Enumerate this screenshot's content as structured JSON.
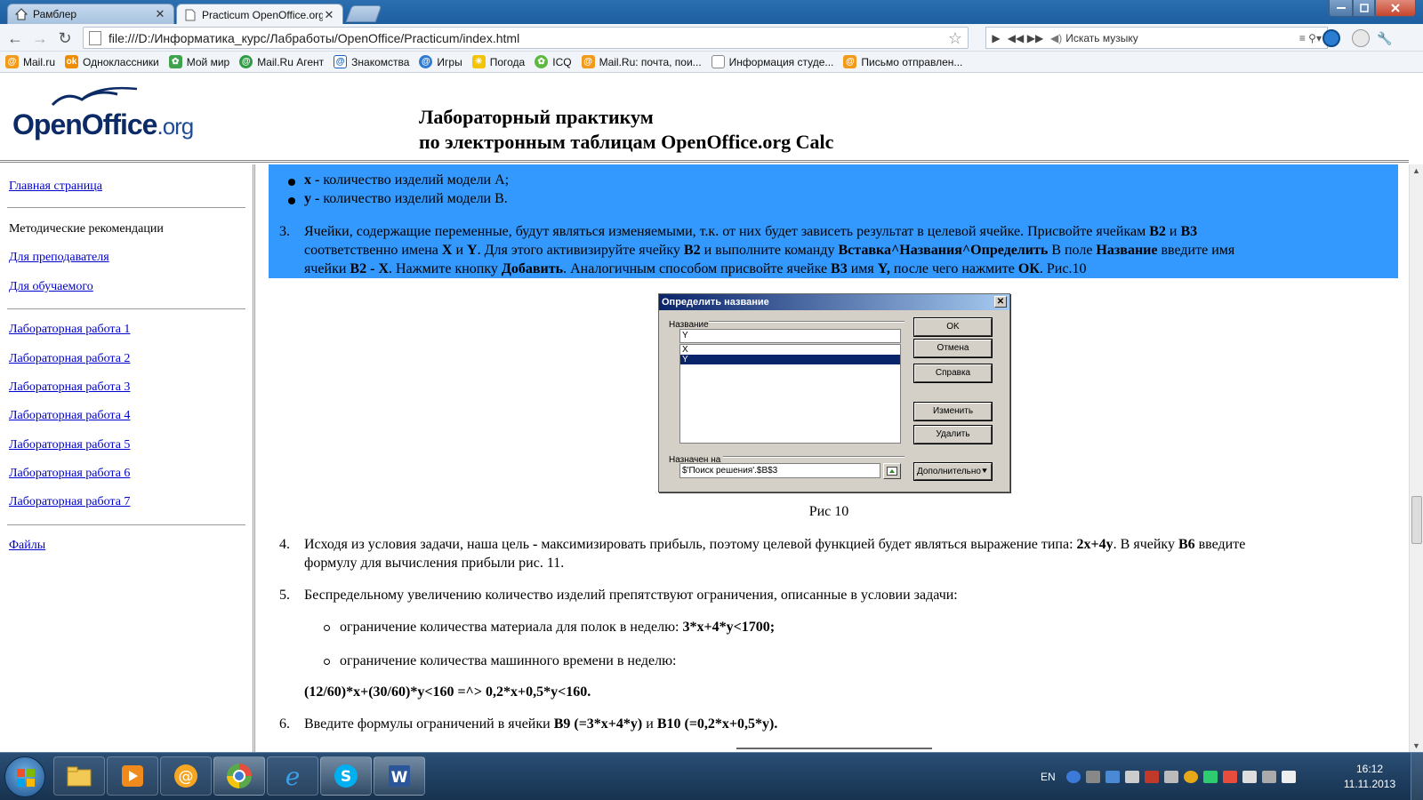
{
  "browser": {
    "tabs": [
      {
        "label": "Рамблер",
        "icon": "home-icon"
      },
      {
        "label": "Practicum OpenOffice.org",
        "icon": "page-icon"
      }
    ],
    "address": "file:///D:/Информатика_курс/Лабработы/OpenOffice/Practicum/index.html",
    "music_search_placeholder": "Искать музыку",
    "bookmarks": [
      {
        "label": "Mail.ru",
        "icon": "mailru-icon"
      },
      {
        "label": "Одноклассники",
        "icon": "odnoklassniki-icon"
      },
      {
        "label": "Мой мир",
        "icon": "my-world-icon"
      },
      {
        "label": "Mail.Ru Агент",
        "icon": "agent-icon"
      },
      {
        "label": "Знакомства",
        "icon": "dating-icon"
      },
      {
        "label": "Игры",
        "icon": "games-icon"
      },
      {
        "label": "Погода",
        "icon": "weather-icon"
      },
      {
        "label": "ICQ",
        "icon": "icq-icon"
      },
      {
        "label": "Mail.Ru: почта, пои...",
        "icon": "mailru-icon"
      },
      {
        "label": "Информация студе...",
        "icon": "page-icon"
      },
      {
        "label": "Письмо отправлен...",
        "icon": "mailru-icon"
      }
    ]
  },
  "header": {
    "logo_text": "OpenOffice",
    "logo_suffix": ".org",
    "title_line1": "Лабораторный практикум",
    "title_line2": "по электронным таблицам OpenOffice.org Calc"
  },
  "sidebar": {
    "home": "Главная страница",
    "method_heading": "Методические рекомендации",
    "for_teacher": "Для преподавателя",
    "for_student": "Для обучаемого",
    "labs": [
      "Лабораторная работа 1",
      "Лабораторная работа 2",
      "Лабораторная работа 3",
      "Лабораторная работа 4",
      "Лабораторная работа 5",
      "Лабораторная работа 6",
      "Лабораторная работа 7"
    ],
    "files": "Файлы"
  },
  "content": {
    "bullet_x": {
      "var": "x -",
      "text": " количество изделий модели А;"
    },
    "bullet_y": {
      "var": "у -",
      "text": " количество изделий модели В."
    },
    "step3": {
      "num": "3.",
      "line1_a": "Ячейки, содержащие переменные, будут являться изменяемыми, т.к. от них будет зависеть результат в целевой ячейке. Присвойте ячейкам ",
      "line1_b2": "B2",
      "line1_and": " и ",
      "line1_b3": "B3",
      "line2_a": "соответственно имена ",
      "line2_x": "X",
      "line2_and": " и ",
      "line2_y": "Y",
      "line2_b": ". Для этого активизируйте ячейку ",
      "line2_b2": "B2",
      "line2_c": " и выполните команду ",
      "line2_cmd": "Вставка^Названия^Определить",
      "line2_d": " В поле ",
      "line2_field": "Название",
      "line2_e": " введите имя",
      "line3_a": "ячейки ",
      "line3_b2x": "B2 - X",
      "line3_b": ". Нажмите кнопку ",
      "line3_add": "Добавить",
      "line3_c": ". Аналогичным способом присвойте ячейке ",
      "line3_b3": "B3",
      "line3_d": " имя ",
      "line3_y": "Y,",
      "line3_e": " после чего нажмите ",
      "line3_ok": "ОК",
      "line3_f": ". Рис.10"
    },
    "figure_caption": "Рис 10",
    "step4": {
      "num": "4.",
      "a": "Исходя из условия задачи, наша цель ",
      "dash": "-",
      "b": " максимизировать прибыль, поэтому целевой функцией будет являться выражение типа: ",
      "expr": "2x+4y",
      "c": ". В ячейку ",
      "cell": "B6",
      "d": " введите",
      "line2": "формулу для вычисления прибыли рис. 11."
    },
    "step5": {
      "num": "5.",
      "text": "Беспредельному увеличению количество изделий препятствуют ограничения, описанные в условии задачи:",
      "c1_text": "ограничение количества материала для полок в неделю: ",
      "c1_expr": "3*x+4*y<1700;",
      "c2_text": "ограничение количества машинного времени в неделю:",
      "formula": "(12/60)*x+(30/60)*y<160 =^> 0,2*x+0,5*y<160."
    },
    "step6": {
      "num": "6.",
      "a": "Введите формулы ограничений в ячейки ",
      "b9": "B9 (=3*x+4*y)",
      "and": " и ",
      "b10": "B10 (=0,2*x+0,5*y)."
    }
  },
  "dialog": {
    "title": "Определить название",
    "name_label": "Название",
    "name_value": "Y",
    "list_items": [
      "X",
      "Y"
    ],
    "selected_item": "Y",
    "buttons": {
      "ok": "OK",
      "cancel": "Отмена",
      "help": "Справка",
      "modify": "Изменить",
      "delete": "Удалить",
      "more": "Дополнительно"
    },
    "assigned_label": "Назначен на",
    "assigned_value": "$'Поиск решения'.$B$3"
  },
  "taskbar": {
    "lang": "EN",
    "time": "16:12",
    "date": "11.11.2013"
  }
}
